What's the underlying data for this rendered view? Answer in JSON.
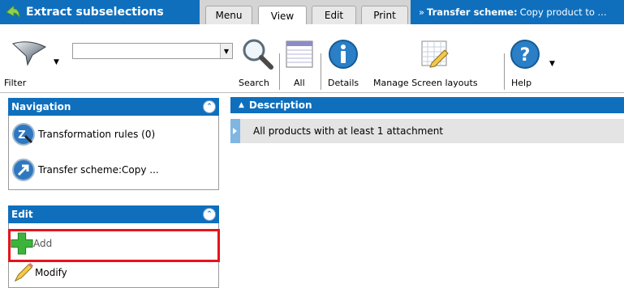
{
  "app": {
    "title": "Extract subselections"
  },
  "tabs": [
    {
      "label": "Menu"
    },
    {
      "label": "View",
      "active": true
    },
    {
      "label": "Edit"
    },
    {
      "label": "Print"
    }
  ],
  "breadcrumb": {
    "prefix": "»",
    "bold": "Transfer scheme:",
    "rest": "Copy product to ..."
  },
  "toolbar": {
    "filter_label": "Filter",
    "search_placeholder": "",
    "search_label": "Search",
    "all_label": "All",
    "details_label": "Details",
    "screen_layouts_label": "Manage Screen layouts",
    "help_label": "Help"
  },
  "navigation": {
    "title": "Navigation",
    "items": [
      {
        "label": "Transformation rules (0)",
        "icon": "transformation-rules-icon"
      },
      {
        "label": "Transfer scheme:Copy ...",
        "icon": "transfer-scheme-icon"
      }
    ]
  },
  "edit": {
    "title": "Edit",
    "items": [
      {
        "label": "Add",
        "icon": "add-icon"
      },
      {
        "label": "Modify",
        "icon": "pencil-icon"
      }
    ]
  },
  "grid": {
    "column": "Description",
    "rows": [
      {
        "description": "All products with at least 1 attachment"
      }
    ]
  },
  "colors": {
    "accent": "#0f6fbd",
    "highlight": "#e5141b",
    "row_bg": "#e4e4e4"
  }
}
